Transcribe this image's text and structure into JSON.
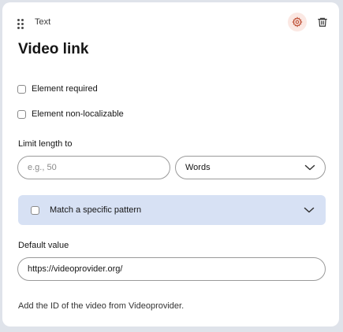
{
  "element": {
    "type_label": "Text",
    "title": "Video link"
  },
  "icons": {
    "drag": "drag-handle-icon",
    "settings": "gear-icon",
    "delete": "trash-icon",
    "dropdown": "chevron-down-icon"
  },
  "options": {
    "required_label": "Element required",
    "required_checked": false,
    "nonlocalizable_label": "Element non-localizable",
    "nonlocalizable_checked": false
  },
  "limit": {
    "label": "Limit length to",
    "placeholder": "e.g., 50",
    "value": "",
    "unit": "Words"
  },
  "pattern": {
    "label": "Match a specific pattern",
    "checked": false
  },
  "default_value": {
    "label": "Default value",
    "value": "https://videoprovider.org/"
  },
  "help_text": "Add the ID of the video from Videoprovider.",
  "colors": {
    "accent_soft": "#fbe8e3",
    "gear": "#c0543a",
    "pattern_bg": "#d7e1f4"
  }
}
